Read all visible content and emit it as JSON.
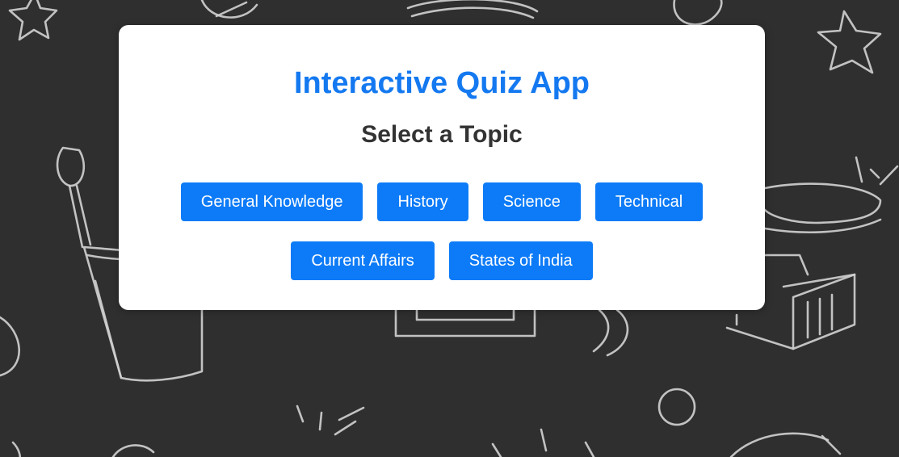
{
  "app": {
    "title": "Interactive Quiz App",
    "subtitle": "Select a Topic"
  },
  "topics": [
    "General Knowledge",
    "History",
    "Science",
    "Technical",
    "Current Affairs",
    "States of India"
  ],
  "colors": {
    "background": "#2f2f2f",
    "card": "#ffffff",
    "title": "#1479f0",
    "subtitle": "#333333",
    "button": "#0d7bf7",
    "button_text": "#ffffff"
  }
}
